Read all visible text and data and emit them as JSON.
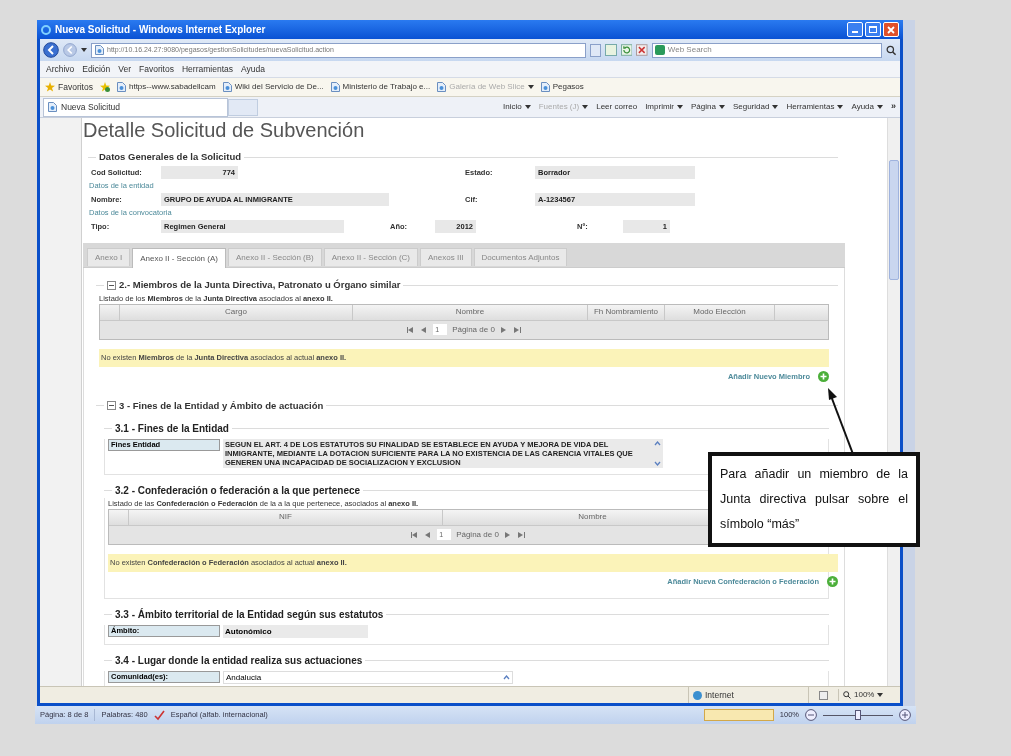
{
  "window": {
    "title": "Nueva Solicitud - Windows Internet Explorer"
  },
  "address_bar": {
    "url": "http://10.16.24.27:9080/pegasos/gestionSolicitudes/nuevaSolicitud.action",
    "search_placeholder": "Web Search"
  },
  "menu": [
    "Archivo",
    "Edición",
    "Ver",
    "Favoritos",
    "Herramientas",
    "Ayuda"
  ],
  "favorites_bar": {
    "label": "Favoritos",
    "links": [
      {
        "label": "https--www.sabadellcam",
        "disabled": false,
        "dropdown": false
      },
      {
        "label": "Wiki del Servicio de De...",
        "disabled": false,
        "dropdown": false
      },
      {
        "label": "Ministerio de Trabajo e...",
        "disabled": false,
        "dropdown": false
      },
      {
        "label": "Galería de Web Slice",
        "disabled": true,
        "dropdown": true
      },
      {
        "label": "Pegasos",
        "disabled": false,
        "dropdown": false
      }
    ]
  },
  "tab": {
    "label": "Nueva Solicitud"
  },
  "command_bar": {
    "items": [
      {
        "label": "Inicio",
        "disabled": false,
        "dropdown": true
      },
      {
        "label": "Fuentes (J)",
        "disabled": true,
        "dropdown": true
      },
      {
        "label": "Leer correo",
        "disabled": false,
        "dropdown": false
      },
      {
        "label": "Imprimir",
        "disabled": false,
        "dropdown": true
      },
      {
        "label": "Página",
        "disabled": false,
        "dropdown": true
      },
      {
        "label": "Seguridad",
        "disabled": false,
        "dropdown": true
      },
      {
        "label": "Herramientas",
        "disabled": false,
        "dropdown": true
      },
      {
        "label": "Ayuda",
        "disabled": false,
        "dropdown": true
      }
    ],
    "overflow": "»"
  },
  "page": {
    "title": "Detalle Solicitud de Subvención",
    "general": {
      "legend": "Datos Generales de la Solicitud",
      "rows": [
        {
          "kind": "fields",
          "fields": [
            {
              "label": "Cod Solicitud:",
              "value": "774",
              "numeric": true
            },
            {
              "label": "Estado:",
              "value": "Borrador",
              "numeric": false
            }
          ]
        },
        {
          "kind": "group",
          "label": "Datos de la entidad"
        },
        {
          "kind": "fields",
          "fields": [
            {
              "label": "Nombre:",
              "value": "GRUPO DE AYUDA AL INMIGRANTE",
              "numeric": false
            },
            {
              "label": "Cif:",
              "value": "A-1234567",
              "numeric": false
            }
          ]
        },
        {
          "kind": "group",
          "label": "Datos de la convocatoria"
        },
        {
          "kind": "fields",
          "fields": [
            {
              "label": "Tipo:",
              "value": "Regimen General",
              "numeric": false
            },
            {
              "label": "Año:",
              "value": "2012",
              "numeric": true
            },
            {
              "label": "Nº:",
              "value": "1",
              "numeric": true
            }
          ]
        }
      ]
    },
    "tabs": [
      {
        "label": "Anexo I",
        "selected": false
      },
      {
        "label": "Anexo II - Sección (A)",
        "selected": true
      },
      {
        "label": "Anexo II - Sección (B)",
        "selected": false
      },
      {
        "label": "Anexo II - Sección (C)",
        "selected": false
      },
      {
        "label": "Anexos III",
        "selected": false
      },
      {
        "label": "Documentos Adjuntos",
        "selected": false
      }
    ],
    "members": {
      "title": "2.- Miembros de la Junta Directiva, Patronato u Órgano similar",
      "grid": {
        "description": "Listado de los **Miembros** de la **Junta Directiva** asociados al **anexo II.**",
        "columns": [
          "Cargo",
          "Nombre",
          "Fh Nombramiento",
          "Modo Elección"
        ],
        "pager": {
          "value": "1",
          "label": "Página",
          "count": "de 0"
        },
        "notice": "No existen **Miembros** de la **Junta Directiva** asociados al actual **anexo II.**",
        "add_link": "Añadir Nuevo Miembro"
      }
    },
    "purposes": {
      "title": "3 - Fines de la Entidad y Ámbito de actuación",
      "subsections": [
        {
          "kind": "textarea",
          "title": "3.1 - Fines de la Entidad",
          "label": "Fines Entidad",
          "value": "SEGUN EL ART. 4 DE LOS ESTATUTOS SU FINALIDAD SE ESTABLECE EN AYUDA Y MEJORA DE VIDA DEL INMIGRANTE, MEDIANTE LA DOTACION SUFICIENTE PARA LA NO EXISTENCIA DE LAS CARENCIA VITALES QUE GENEREN UNA INCAPACIDAD DE SOCIALIZACION Y EXCLUSION"
        },
        {
          "kind": "grid",
          "title": "3.2 - Confederación o federación a la que pertenece",
          "grid": {
            "description": "Listado de las **Confederación o Federación** de la a la que pertenece, asociados al **anexo II.**",
            "columns": [
              "NIF",
              "Nombre"
            ],
            "pager": {
              "value": "1",
              "label": "Página",
              "count": "de 0"
            },
            "notice": "No existen **Confederación o Federación** asociados al actual **anexo II.**",
            "add_link": "Añadir Nueva Confederación o Federación"
          }
        },
        {
          "kind": "field",
          "title": "3.3 - Ámbito territorial de la Entidad según sus estatutos",
          "label": "Ámbito:",
          "value": "Autonómico"
        },
        {
          "kind": "list",
          "title": "3.4 - Lugar donde la entidad realiza sus actuaciones",
          "label": "Comunidad(es):",
          "value": "Andalucia"
        }
      ]
    }
  },
  "status_bar": {
    "zone": "Internet",
    "zoom": "100%"
  },
  "word_status": {
    "page": "Página: 8 de 8",
    "words": "Palabras: 480",
    "language": "Español (alfab. internacional)",
    "zoom": "100%",
    "zoom_slider": {
      "level": 0.5
    }
  },
  "callout": {
    "text": "Para añadir un miembro de la Junta directiva pulsar sobre el símbolo “más”"
  }
}
